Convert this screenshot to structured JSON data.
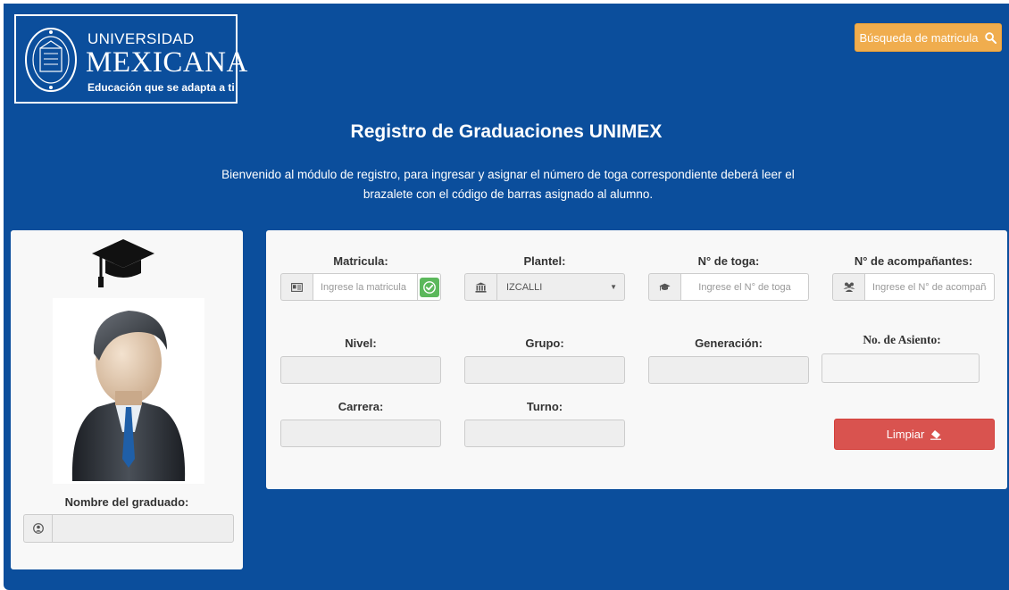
{
  "logo": {
    "line1": "UNIVERSIDAD",
    "line2": "MEXICANA",
    "tagline": "Educación que se adapta a ti"
  },
  "header": {
    "search_button_label": "Búsqueda de matricula",
    "search_icon": "search-icon",
    "title": "Registro de Graduaciones UNIMEX",
    "intro": "Bienvenido al módulo de registro, para ingresar y asignar el número de toga correspondiente deberá leer el brazalete con el código de barras asignado al alumno."
  },
  "graduate": {
    "cap_icon": "graduation-cap-icon",
    "avatar_icon": "businessman-avatar-icon",
    "name_label": "Nombre del graduado:",
    "name_value": "",
    "name_icon": "user-circle-icon"
  },
  "form": {
    "matricula": {
      "label": "Matricula:",
      "placeholder": "Ingrese la matricula",
      "icon": "id-card-icon",
      "ok_icon": "check-icon"
    },
    "plantel": {
      "label": "Plantel:",
      "selected": "IZCALLI",
      "icon": "institution-icon"
    },
    "toga": {
      "label": "N° de toga:",
      "placeholder": "Ingrese el N° de toga",
      "icon": "graduation-cap-icon"
    },
    "acompanantes": {
      "label": "N° de acompañantes:",
      "placeholder": "Ingrese el N° de acompañantes",
      "icon": "users-icon"
    },
    "nivel": {
      "label": "Nivel:",
      "value": ""
    },
    "grupo": {
      "label": "Grupo:",
      "value": ""
    },
    "generacion": {
      "label": "Generación:",
      "value": ""
    },
    "asiento": {
      "label": "No. de Asiento:",
      "value": ""
    },
    "carrera": {
      "label": "Carrera:",
      "value": ""
    },
    "turno": {
      "label": "Turno:",
      "value": ""
    },
    "clear_button_label": "Limpiar",
    "clear_icon": "eraser-icon"
  },
  "colors": {
    "background": "#0b4e9c",
    "search_button": "#f0ad4e",
    "clear_button": "#d9534f",
    "ok_badge": "#5cb85c"
  }
}
